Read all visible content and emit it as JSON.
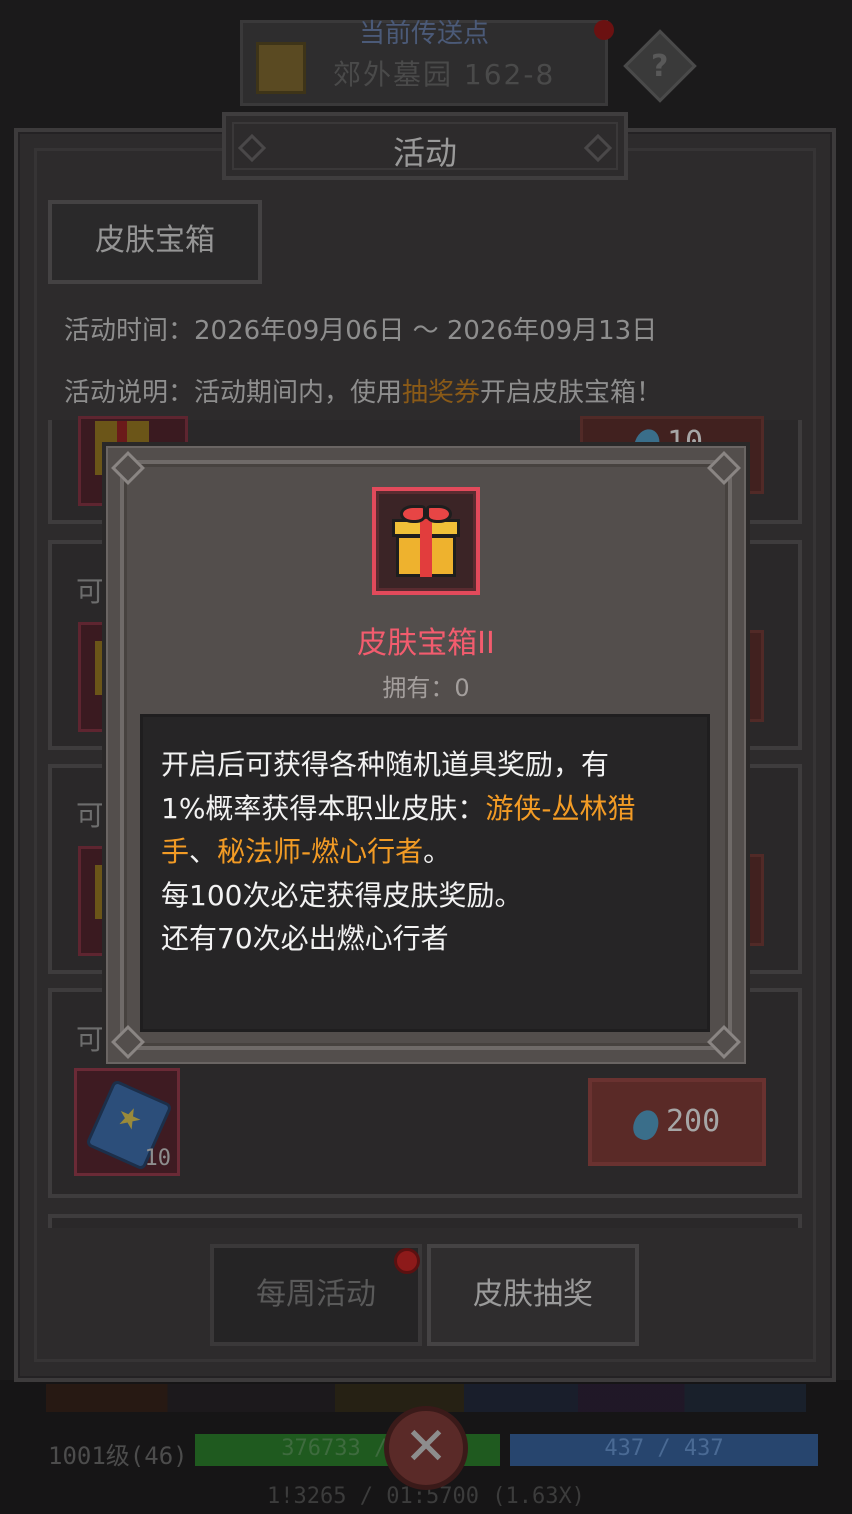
{
  "background": {
    "header_subtitle": "当前传送点",
    "header_title": "郊外墓园 162-8",
    "help_symbol": "?",
    "player_level": "1001级(46)",
    "hp_text": "376733 / 3",
    "mp_text": "437 / 437",
    "exp_text": "1!3265 / 01:5700 (1.63X)"
  },
  "panel": {
    "title": "活动",
    "skin_tab": "皮肤宝箱",
    "time_label": "活动时间：",
    "time_value": "2026年09月06日 ～ 2026年09月13日",
    "desc_label": "活动说明：",
    "desc_prefix": "活动期间内，使用",
    "desc_highlight": "抽奖券",
    "desc_suffix": "开启皮肤宝箱！",
    "card_can_label": "可",
    "card_partial_price": "10",
    "ticket_count": "10",
    "buy_price": "200",
    "bottom_tabs": {
      "weekly": "每周活动",
      "lottery": "皮肤抽奖"
    },
    "close_symbol": "✕"
  },
  "modal": {
    "item_name": "皮肤宝箱II",
    "owned_label": "拥有：",
    "owned_count": "0",
    "desc": {
      "line1": "开启后可获得各种随机道具奖励，有",
      "line2_prefix": "1%概率获得本职业皮肤：",
      "skin1": "游侠-丛林猎",
      "skin1_tail": "手",
      "sep": "、",
      "skin2": "秘法师-燃心行者",
      "line3_end": "。",
      "line4": "每100次必定获得皮肤奖励。",
      "line5": "还有70次必出燃心行者"
    }
  },
  "colors": {
    "item_name": "#f25c6e",
    "highlight_orange": "#f29b25",
    "item_frame": "#e24a5b"
  },
  "icons": [
    "map-icon",
    "help-icon",
    "gift-box-icon",
    "lottery-ticket-icon",
    "gem-icon",
    "close-icon"
  ]
}
